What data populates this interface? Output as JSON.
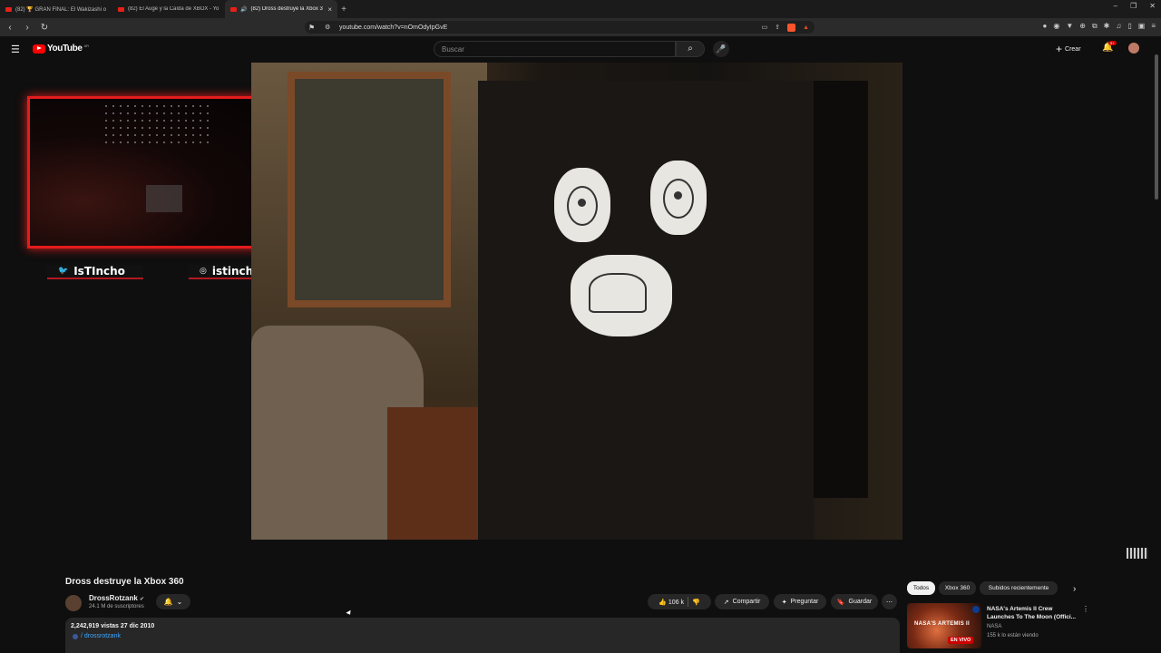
{
  "browser": {
    "tabs": [
      {
        "title": "(82) 🏆 GRAN FINAL: El Wakizashi o",
        "active": false
      },
      {
        "title": "(82) El Auge y la Caída de XBOX - Yo",
        "active": false
      },
      {
        "title": "(82) Dross destruye la Xbox 3",
        "active": true
      }
    ],
    "new_tab": "+",
    "window_controls": [
      "–",
      "❐",
      "✕"
    ],
    "url": "youtube.com/watch?v=nOmOdyIpGvE"
  },
  "youtube": {
    "logo_text": "YouTube",
    "country": "AR",
    "search_placeholder": "Buscar",
    "create_label": "Crear",
    "notifications": "9+"
  },
  "overlay": {
    "twitter": "IsTIncho",
    "instagram": "istincho_"
  },
  "video": {
    "title": "Dross destruye la Xbox 360",
    "channel": "DrossRotzank",
    "subscribers": "24.1 M de suscriptores",
    "likes": "106 k",
    "share_label": "Compartir",
    "ask_label": "Preguntar",
    "save_label": "Guardar",
    "views_date": "2,242,919 vistas  27 dic 2010",
    "desc_handle": "/ drossrotzank"
  },
  "sidebar": {
    "chips": [
      "Todos",
      "Xbox 360",
      "Subidos recientemente"
    ],
    "recommendation": {
      "thumb_text": "NASA'S ARTEMIS II",
      "live_badge": "EN VIVO",
      "title": "NASA's Artemis II Crew Launches To The Moon (Offici...",
      "channel": "NASA",
      "viewers": "155 k lo están viendo"
    }
  },
  "colors": {
    "accent_red": "#ff0000",
    "overlay_red": "#e31c1c",
    "link_blue": "#3ea6ff"
  }
}
